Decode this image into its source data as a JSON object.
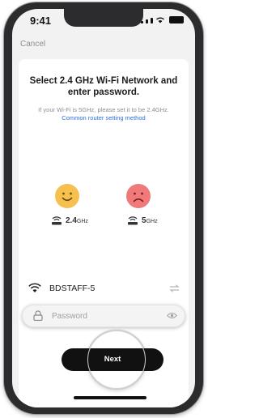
{
  "status_bar": {
    "time": "9:41"
  },
  "nav": {
    "cancel_label": "Cancel"
  },
  "content": {
    "title": "Select 2.4 GHz Wi-Fi Network and enter password.",
    "subtitle": "If your Wi-Fi is 5GHz, please set it to be 2.4GHz.",
    "subtitle_link": "Common router setting method"
  },
  "bands": [
    {
      "icon": "happy-face-icon",
      "value": "2.4",
      "suffix": "GHz",
      "color": "#f5c04e"
    },
    {
      "icon": "sad-face-icon",
      "value": "5",
      "suffix": "GHz",
      "color": "#f07a7a"
    }
  ],
  "wifi": {
    "network_name": "BDSTAFF-5"
  },
  "password": {
    "placeholder": "Password",
    "value": ""
  },
  "actions": {
    "next_label": "Next"
  }
}
